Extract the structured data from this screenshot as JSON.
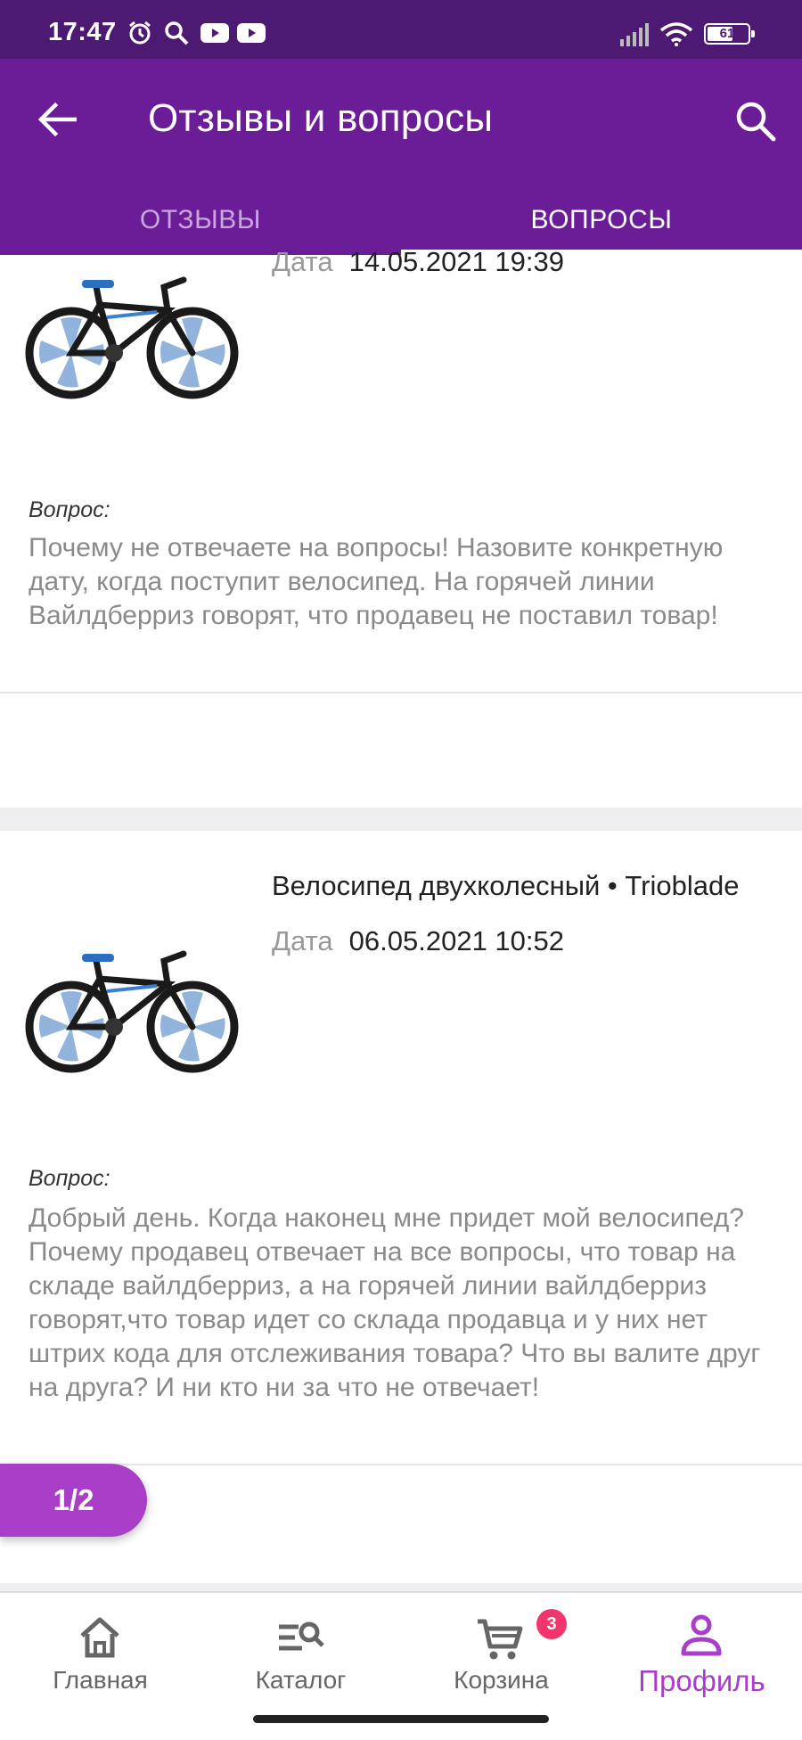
{
  "status_bar": {
    "time": "17:47",
    "battery": "61"
  },
  "header": {
    "title": "Отзывы и вопросы"
  },
  "tabs": [
    {
      "label": "ОТЗЫВЫ",
      "active": false
    },
    {
      "label": "ВОПРОСЫ",
      "active": true
    }
  ],
  "questions": [
    {
      "product": "",
      "date_label": "Дата",
      "date": "14.05.2021 19:39",
      "question_label": "Вопрос:",
      "text": "Почему не отвечаете на вопросы! Назовите конкретную дату, когда поступит велосипед. На горячей линии Вайлдберриз говорят, что продавец не поставил товар!"
    },
    {
      "product": "Велосипед двухколесный • Trioblade",
      "date_label": "Дата",
      "date": "06.05.2021 10:52",
      "question_label": "Вопрос:",
      "text": "Добрый день. Когда наконец мне придет мой велосипед? Почему продавец отвечает на все вопросы, что товар на складе вайлдберриз, а на горячей линии вайлдберриз говорят,что товар идет со склада продавца и у них нет штрих кода для отслеживания товара? Что вы валите друг на друга? И ни кто ни за что не отвечает!"
    }
  ],
  "pager": {
    "label": "1/2"
  },
  "bottom_nav": [
    {
      "label": "Главная",
      "icon": "home-icon"
    },
    {
      "label": "Каталог",
      "icon": "catalog-search-icon"
    },
    {
      "label": "Корзина",
      "icon": "cart-icon",
      "badge": "3"
    },
    {
      "label": "Профиль",
      "icon": "profile-icon",
      "active": true
    }
  ],
  "colors": {
    "status_bar": "#4d1a73",
    "app_bar": "#6b1d97",
    "accent": "#a93fc8",
    "badge": "#f2356c"
  }
}
